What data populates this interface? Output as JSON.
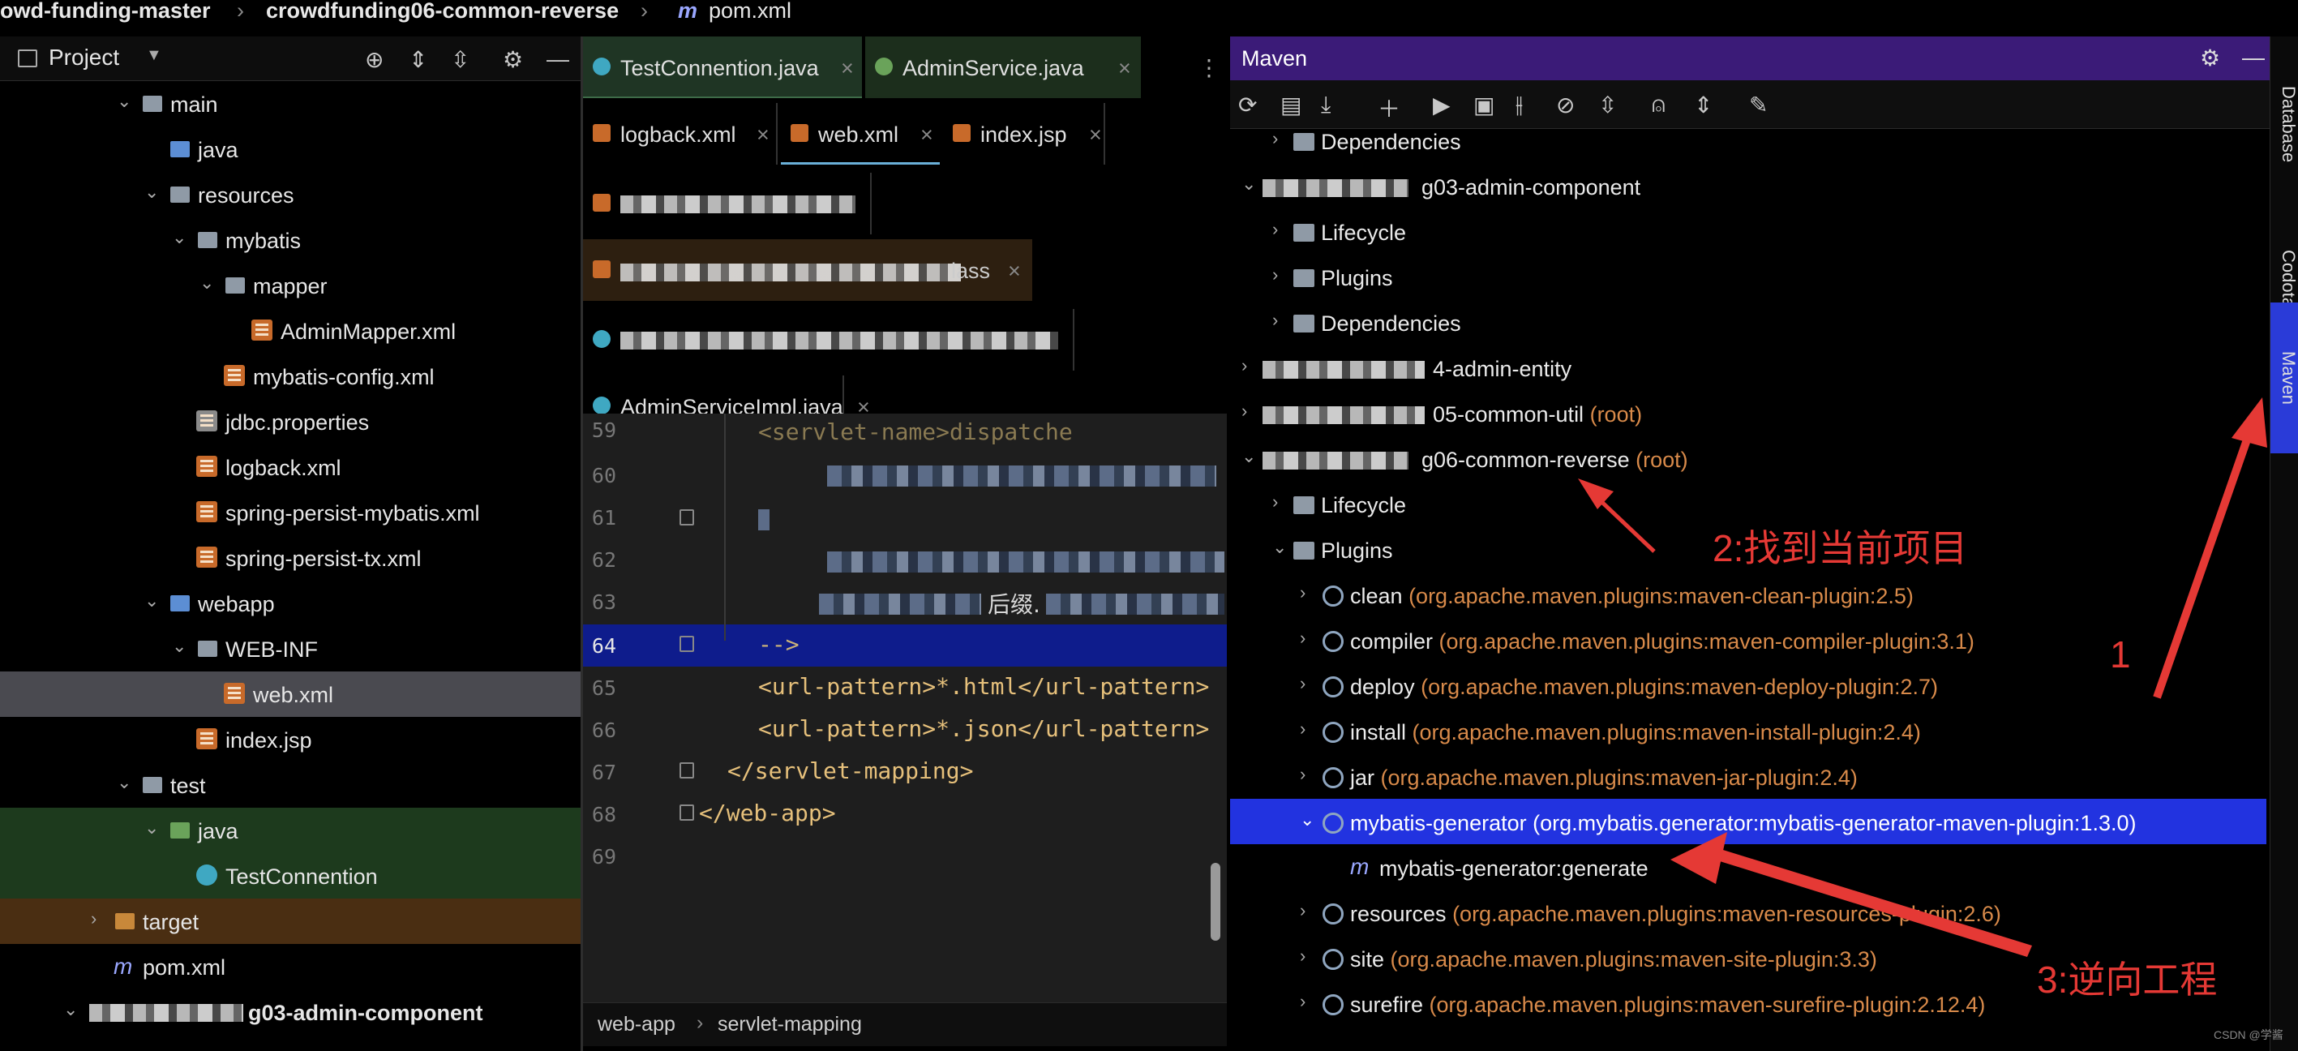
{
  "breadcrumb": {
    "project": "owd-funding-master",
    "module": "crowdfunding06-common-reverse",
    "file": "pom.xml"
  },
  "project_panel": {
    "title": "Project",
    "tree": [
      {
        "label": "main",
        "type": "folder"
      },
      {
        "label": "java",
        "type": "folder-blue"
      },
      {
        "label": "resources",
        "type": "folder"
      },
      {
        "label": "mybatis",
        "type": "folder"
      },
      {
        "label": "mapper",
        "type": "folder"
      },
      {
        "label": "AdminMapper.xml",
        "type": "xml"
      },
      {
        "label": "mybatis-config.xml",
        "type": "xml"
      },
      {
        "label": "jdbc.properties",
        "type": "xml"
      },
      {
        "label": "logback.xml",
        "type": "xml"
      },
      {
        "label": "spring-persist-mybatis.xml",
        "type": "xml"
      },
      {
        "label": "spring-persist-tx.xml",
        "type": "xml"
      },
      {
        "label": "webapp",
        "type": "folder-blue"
      },
      {
        "label": "WEB-INF",
        "type": "folder"
      },
      {
        "label": "web.xml",
        "type": "xml"
      },
      {
        "label": "index.jsp",
        "type": "xml"
      },
      {
        "label": "test",
        "type": "folder"
      },
      {
        "label": "java",
        "type": "folder-green"
      },
      {
        "label": "TestConnention",
        "type": "class"
      },
      {
        "label": "target",
        "type": "folder-orange"
      },
      {
        "label": "pom.xml",
        "type": "maven"
      },
      {
        "label": "g03-admin-component",
        "type": "module"
      }
    ]
  },
  "editor": {
    "tabs": [
      {
        "label": "TestConnention.java"
      },
      {
        "label": "AdminService.java"
      },
      {
        "label": "logback.xml"
      },
      {
        "label": "web.xml"
      },
      {
        "label": "index.jsp"
      },
      {
        "label": "AdminServiceImpl.java"
      }
    ],
    "partial_tab_suffix": "lass",
    "line_numbers": [
      "59",
      "60",
      "61",
      "62",
      "63",
      "64",
      "65",
      "66",
      "67",
      "68",
      "69"
    ],
    "lines": {
      "l59": "<servlet-name>dispatche",
      "l63_suffix": "后缀.",
      "l64": "-->",
      "l65": "<url-pattern>*.html</url-pattern>",
      "l66": "<url-pattern>*.json</url-pattern>",
      "l67": "</servlet-mapping>",
      "l68": "</web-app>"
    },
    "status": {
      "crumb1": "web-app",
      "crumb2": "servlet-mapping"
    }
  },
  "maven_panel": {
    "title": "Maven",
    "tree": [
      {
        "label": "Dependencies",
        "sub": ""
      },
      {
        "label": "g03-admin-component",
        "sub": ""
      },
      {
        "label": "Lifecycle",
        "sub": ""
      },
      {
        "label": "Plugins",
        "sub": ""
      },
      {
        "label": "Dependencies",
        "sub": ""
      },
      {
        "label": "4-admin-entity",
        "sub": ""
      },
      {
        "label": "05-common-util",
        "sub": "(root)"
      },
      {
        "label": "g06-common-reverse",
        "sub": "(root)"
      },
      {
        "label": "Lifecycle",
        "sub": ""
      },
      {
        "label": "Plugins",
        "sub": ""
      },
      {
        "label": "clean",
        "sub": "(org.apache.maven.plugins:maven-clean-plugin:2.5)"
      },
      {
        "label": "compiler",
        "sub": "(org.apache.maven.plugins:maven-compiler-plugin:3.1)"
      },
      {
        "label": "deploy",
        "sub": "(org.apache.maven.plugins:maven-deploy-plugin:2.7)"
      },
      {
        "label": "install",
        "sub": "(org.apache.maven.plugins:maven-install-plugin:2.4)"
      },
      {
        "label": "jar",
        "sub": "(org.apache.maven.plugins:maven-jar-plugin:2.4)"
      },
      {
        "label": "mybatis-generator",
        "sub": "(org.mybatis.generator:mybatis-generator-maven-plugin:1.3.0)"
      },
      {
        "label": "mybatis-generator:generate",
        "sub": ""
      },
      {
        "label": "resources",
        "sub": "(org.apache.maven.plugins:maven-resources-plugin:2.6)"
      },
      {
        "label": "site",
        "sub": "(org.apache.maven.plugins:maven-site-plugin:3.3)"
      },
      {
        "label": "surefire",
        "sub": "(org.apache.maven.plugins:maven-surefire-plugin:2.12.4)"
      }
    ]
  },
  "side_stripe": {
    "tabs": [
      "Database",
      "Codota",
      "Maven"
    ]
  },
  "annotations": {
    "a1": "1",
    "a2": "2:找到当前项目",
    "a3": "3:逆向工程"
  },
  "watermark": "CSDN @学酱",
  "colors": {
    "selection": "#2233e0",
    "maven_header": "#3b1b78",
    "annotation": "#e53935",
    "plugin_coords": "#d88a4a"
  }
}
